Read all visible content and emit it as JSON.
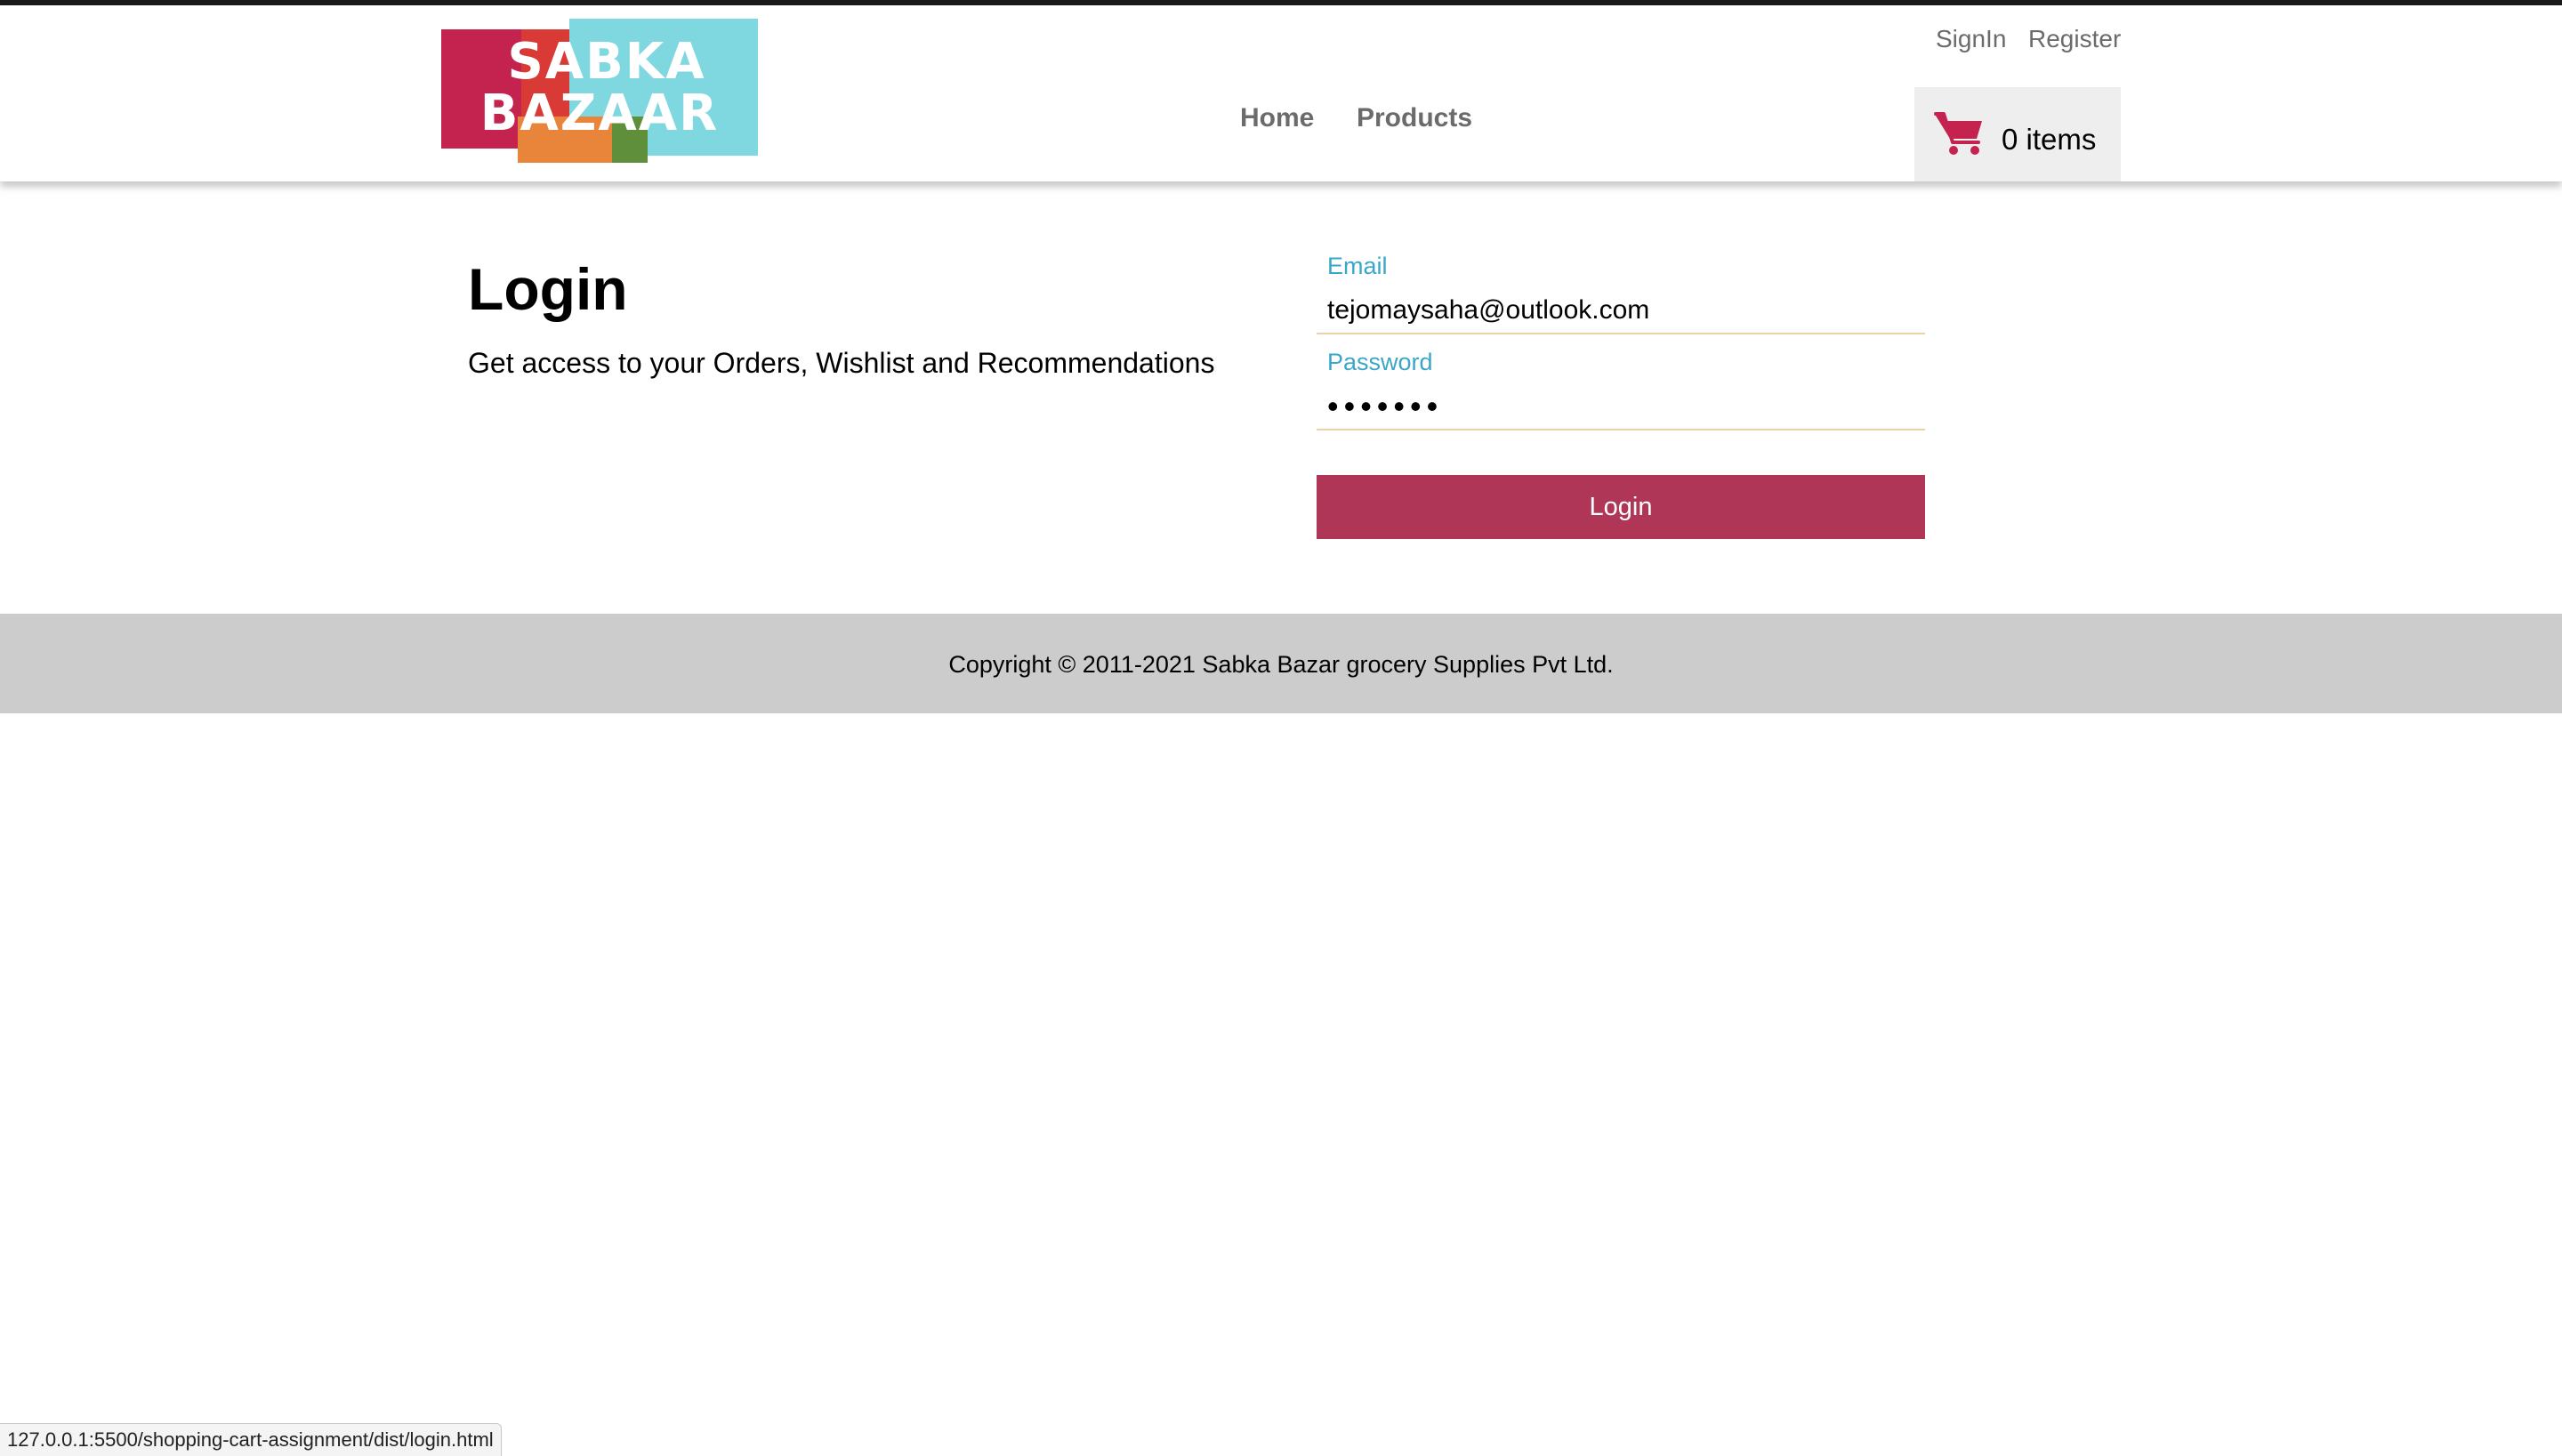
{
  "header": {
    "logo": {
      "line1": "SABKA",
      "line2": "BAZAAR"
    },
    "nav": {
      "home": "Home",
      "products": "Products"
    },
    "auth": {
      "signin": "SignIn",
      "register": "Register"
    },
    "cart": {
      "icon": "cart-icon",
      "count_label": "0 items",
      "icon_color": "#c4234f"
    }
  },
  "main": {
    "title": "Login",
    "subtitle": "Get access to your Orders, Wishlist and Recommendations",
    "form": {
      "email_label": "Email",
      "email_value": "tejomaysaha@outlook.com",
      "password_label": "Password",
      "password_value": "1234567",
      "submit_label": "Login"
    }
  },
  "footer": {
    "copyright": "Copyright © 2011-2021 Sabka Bazar grocery Supplies Pvt Ltd."
  },
  "status_bar": {
    "url": "127.0.0.1:5500/shopping-cart-assignment/dist/login.html"
  },
  "colors": {
    "accent": "#b03657",
    "label": "#3aa6c8",
    "footer_bg": "#cccccc"
  }
}
